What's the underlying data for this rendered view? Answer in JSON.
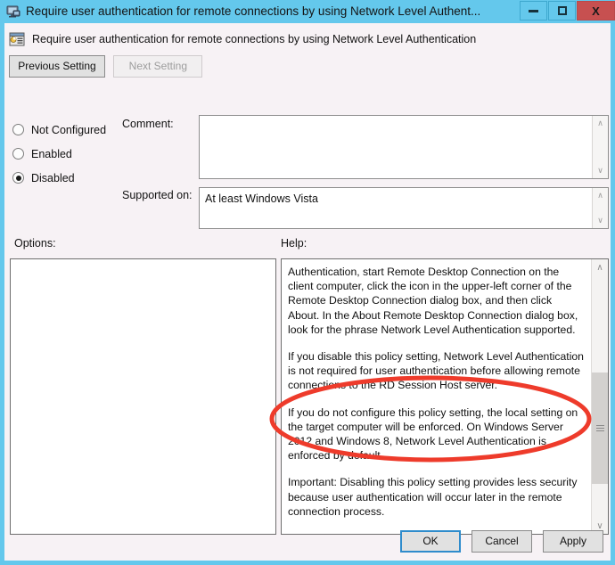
{
  "window": {
    "title": "Require user authentication for remote connections by using Network Level Authent...",
    "icon": "remote-desktop-icon",
    "minimize_label": "Minimize",
    "maximize_label": "Restore",
    "close_label": "X"
  },
  "policy": {
    "icon": "group-policy-setting-icon",
    "name": "Require user authentication for remote connections by using Network Level Authentication"
  },
  "navigation": {
    "previous_label": "Previous Setting",
    "next_label": "Next Setting",
    "next_disabled": true
  },
  "state_options": [
    {
      "label": "Not Configured",
      "selected": false
    },
    {
      "label": "Enabled",
      "selected": false
    },
    {
      "label": "Disabled",
      "selected": true
    }
  ],
  "fields": {
    "comment_label": "Comment:",
    "comment_value": "",
    "supported_label": "Supported on:",
    "supported_value": "At least Windows Vista"
  },
  "panes": {
    "options_label": "Options:",
    "options_content": "",
    "help_label": "Help:",
    "help_paragraphs": [
      "Authentication, start Remote Desktop Connection on the client computer, click the icon in the upper-left corner of the Remote Desktop Connection dialog box, and then click About. In the About Remote Desktop Connection dialog box, look for the phrase Network Level Authentication supported.",
      "If you disable this policy setting, Network Level Authentication is not required for user authentication before allowing remote connections to the RD Session Host server.",
      "If you do not configure this policy setting, the local setting on the target computer will be enforced. On Windows Server 2012 and Windows 8, Network Level Authentication is enforced by default.",
      "Important: Disabling this policy setting provides less security because user authentication will occur later in the remote connection process."
    ],
    "scroll_up_glyph": "∧",
    "scroll_down_glyph": "∨"
  },
  "footer": {
    "ok_label": "OK",
    "cancel_label": "Cancel",
    "apply_label": "Apply"
  },
  "annotation": {
    "shape": "red-ellipse-highlight",
    "color": "#ee3b2b",
    "target_paragraph_index": 2
  },
  "colors": {
    "title_bar": "#64c8ec",
    "close_button": "#c75050",
    "dialog_background": "#f7f2f5",
    "accent_focus": "#2f8ccc"
  }
}
